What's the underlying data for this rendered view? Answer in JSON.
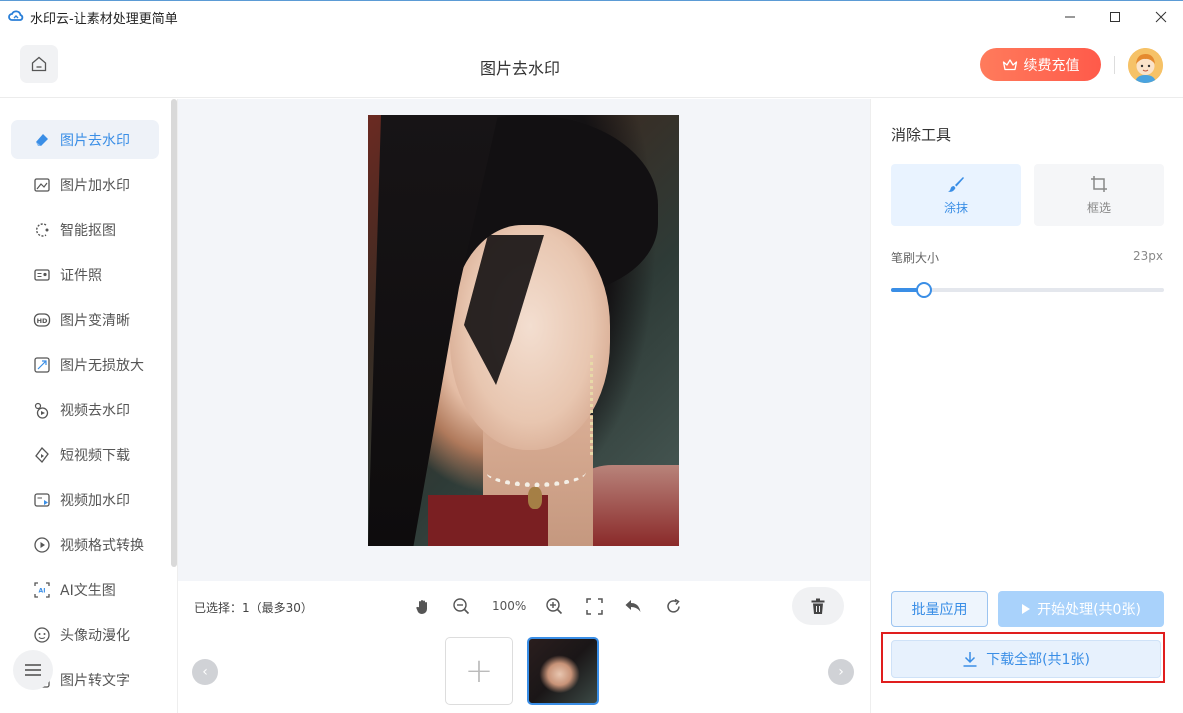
{
  "window": {
    "title": "水印云-让素材处理更简单",
    "min_icon": "minimize-icon",
    "max_icon": "maximize-icon",
    "close_icon": "close-icon"
  },
  "header": {
    "title": "图片去水印",
    "vip_button": "续费充值",
    "home_icon": "home-icon",
    "crown_icon": "crown-icon"
  },
  "sidebar": {
    "items": [
      {
        "label": "图片去水印",
        "icon": "eraser-icon",
        "active": true
      },
      {
        "label": "图片加水印",
        "icon": "image-add-icon"
      },
      {
        "label": "智能抠图",
        "icon": "cutout-icon"
      },
      {
        "label": "证件照",
        "icon": "id-card-icon"
      },
      {
        "label": "图片变清晰",
        "icon": "hd-icon"
      },
      {
        "label": "图片无损放大",
        "icon": "enlarge-icon"
      },
      {
        "label": "视频去水印",
        "icon": "video-eraser-icon"
      },
      {
        "label": "短视频下载",
        "icon": "video-download-icon"
      },
      {
        "label": "视频加水印",
        "icon": "video-add-icon"
      },
      {
        "label": "视频格式转换",
        "icon": "convert-icon"
      },
      {
        "label": "AI文生图",
        "icon": "ai-image-icon"
      },
      {
        "label": "头像动漫化",
        "icon": "anime-avatar-icon"
      },
      {
        "label": "图片转文字",
        "icon": "ocr-icon"
      }
    ],
    "menu_icon": "menu-icon"
  },
  "toolbar": {
    "selection_info": "已选择：1（最多30）",
    "zoom": "100%",
    "icons": [
      "hand-icon",
      "zoom-out-icon",
      "zoom-in-icon",
      "fit-screen-icon",
      "undo-icon",
      "reset-icon"
    ],
    "trash_icon": "trash-icon"
  },
  "thumbnails": {
    "add_symbol": "+",
    "prev_symbol": "‹",
    "next_symbol": "›"
  },
  "right_panel": {
    "title": "消除工具",
    "tools": [
      {
        "label": "涂抹",
        "icon": "brush-icon",
        "active": true
      },
      {
        "label": "框选",
        "icon": "crop-icon",
        "active": false
      }
    ],
    "brush_size_label": "笔刷大小",
    "brush_size_value": "23px",
    "brush_size_level": 0.12,
    "batch_button": "批量应用",
    "start_button": "开始处理(共0张)",
    "download_button": "下载全部(共1张)"
  },
  "colors": {
    "accent": "#3a8ee6",
    "vip": "#ff5a4a",
    "highlight": "#e01e1e"
  }
}
